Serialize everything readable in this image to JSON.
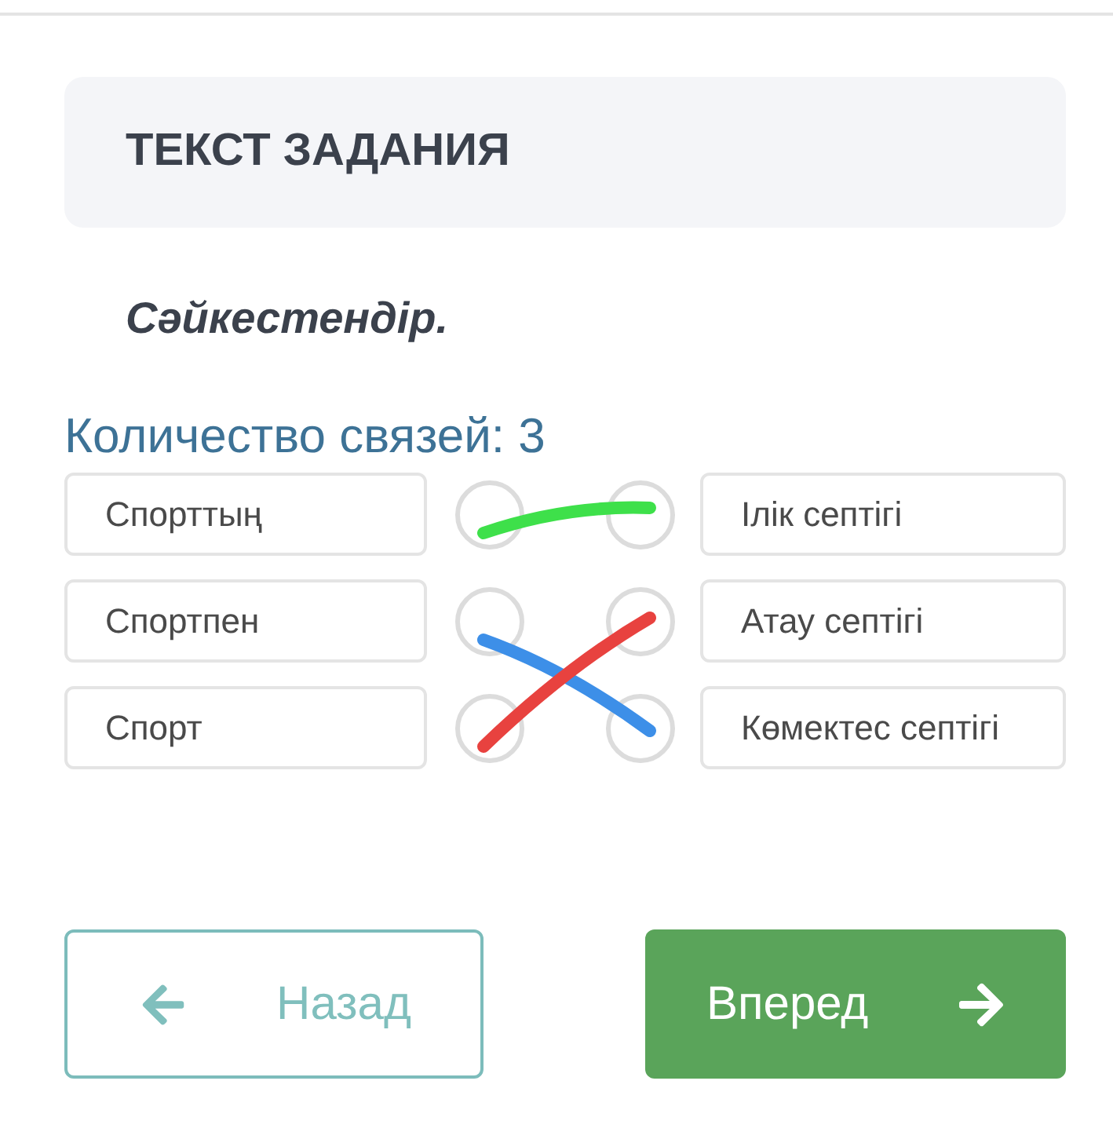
{
  "header": {
    "title": "ТЕКСТ ЗАДАНИЯ"
  },
  "instruction": "Сәйкестендір.",
  "match": {
    "count_label": "Количество связей: 3",
    "left": [
      {
        "text": "Спорттың",
        "color": "#3ee04a"
      },
      {
        "text": "Спортпен",
        "color": "#3d8fe8"
      },
      {
        "text": "Спорт",
        "color": "#e8423f"
      }
    ],
    "right": [
      {
        "text": "Ілік септігі",
        "color": "#3ee04a"
      },
      {
        "text": "Атау септігі",
        "color": "#e8423f"
      },
      {
        "text": "Көмектес септігі",
        "color": "#3d8fe8"
      }
    ]
  },
  "buttons": [
    {
      "kind": "back",
      "label": "Назад"
    },
    {
      "kind": "forward",
      "label": "Вперед"
    }
  ]
}
